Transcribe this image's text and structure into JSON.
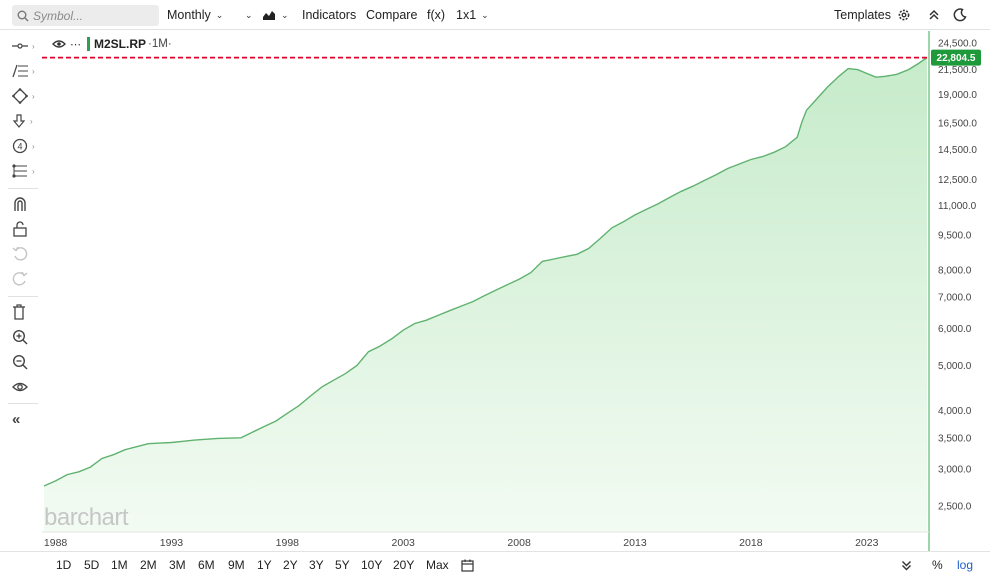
{
  "toolbar": {
    "search_placeholder": "Symbol...",
    "interval": "Monthly",
    "indicators": "Indicators",
    "compare": "Compare",
    "fx": "f(x)",
    "layout": "1x1",
    "templates": "Templates"
  },
  "legend": {
    "symbol": "M2SL.RP",
    "timeframe": "·1M·"
  },
  "watermark": "barchart",
  "range_buttons": [
    "1D",
    "5D",
    "1M",
    "2M",
    "3M",
    "6M",
    "9M",
    "1Y",
    "2Y",
    "3Y",
    "5Y",
    "10Y",
    "20Y",
    "Max"
  ],
  "bottom_right": {
    "percent": "%",
    "log": "log"
  },
  "colors": {
    "line": "#5fb26f",
    "fill": "#d4f0d6",
    "last_price_label": "#1f9a3b",
    "last_price_line": "#e2002a",
    "axis_line": "#3daa55"
  },
  "chart_data": {
    "type": "area",
    "scale": "log",
    "last_value": "22,804.5",
    "ylim": [
      2200,
      26000
    ],
    "xlim": [
      1987.5,
      2025.6
    ],
    "y_ticks": [
      "2,500.0",
      "3,000.0",
      "3,500.0",
      "4,000.0",
      "5,000.0",
      "6,000.0",
      "7,000.0",
      "8,000.0",
      "9,500.0",
      "11,000.0",
      "12,500.0",
      "14,500.0",
      "16,500.0",
      "19,000.0",
      "21,500.0",
      "24,500.0"
    ],
    "x_ticks": [
      "1988",
      "1993",
      "1998",
      "2003",
      "2008",
      "2013",
      "2018",
      "2023"
    ],
    "points": [
      [
        1987.5,
        2760
      ],
      [
        1988.0,
        2830
      ],
      [
        1988.5,
        2920
      ],
      [
        1989.0,
        2960
      ],
      [
        1989.5,
        3030
      ],
      [
        1990.0,
        3160
      ],
      [
        1990.5,
        3220
      ],
      [
        1991.0,
        3300
      ],
      [
        1991.5,
        3350
      ],
      [
        1992.0,
        3400
      ],
      [
        1992.5,
        3410
      ],
      [
        1993.0,
        3420
      ],
      [
        1993.5,
        3440
      ],
      [
        1994.0,
        3460
      ],
      [
        1995.0,
        3490
      ],
      [
        1996.0,
        3500
      ],
      [
        1996.5,
        3600
      ],
      [
        1997.0,
        3700
      ],
      [
        1997.5,
        3800
      ],
      [
        1998.0,
        3950
      ],
      [
        1998.5,
        4100
      ],
      [
        1999.0,
        4300
      ],
      [
        1999.5,
        4500
      ],
      [
        2000.0,
        4650
      ],
      [
        2000.5,
        4800
      ],
      [
        2001.0,
        5000
      ],
      [
        2001.5,
        5350
      ],
      [
        2002.0,
        5500
      ],
      [
        2002.5,
        5700
      ],
      [
        2003.0,
        5950
      ],
      [
        2003.5,
        6150
      ],
      [
        2004.0,
        6250
      ],
      [
        2004.5,
        6400
      ],
      [
        2005.0,
        6550
      ],
      [
        2005.5,
        6700
      ],
      [
        2006.0,
        6850
      ],
      [
        2006.5,
        7050
      ],
      [
        2007.0,
        7250
      ],
      [
        2007.5,
        7450
      ],
      [
        2008.0,
        7650
      ],
      [
        2008.5,
        7900
      ],
      [
        2009.0,
        8350
      ],
      [
        2009.5,
        8450
      ],
      [
        2010.0,
        8550
      ],
      [
        2010.5,
        8650
      ],
      [
        2011.0,
        8900
      ],
      [
        2011.5,
        9350
      ],
      [
        2012.0,
        9850
      ],
      [
        2012.5,
        10150
      ],
      [
        2013.0,
        10500
      ],
      [
        2013.5,
        10800
      ],
      [
        2014.0,
        11100
      ],
      [
        2014.5,
        11450
      ],
      [
        2015.0,
        11800
      ],
      [
        2015.5,
        12100
      ],
      [
        2016.0,
        12450
      ],
      [
        2016.5,
        12800
      ],
      [
        2017.0,
        13200
      ],
      [
        2017.5,
        13500
      ],
      [
        2018.0,
        13800
      ],
      [
        2018.5,
        14000
      ],
      [
        2019.0,
        14300
      ],
      [
        2019.5,
        14700
      ],
      [
        2020.0,
        15400
      ],
      [
        2020.2,
        16600
      ],
      [
        2020.4,
        17600
      ],
      [
        2020.8,
        18500
      ],
      [
        2021.3,
        19700
      ],
      [
        2021.8,
        20800
      ],
      [
        2022.2,
        21600
      ],
      [
        2022.6,
        21500
      ],
      [
        2023.0,
        21100
      ],
      [
        2023.4,
        20700
      ],
      [
        2023.8,
        20800
      ],
      [
        2024.3,
        21000
      ],
      [
        2024.8,
        21500
      ],
      [
        2025.2,
        22100
      ],
      [
        2025.6,
        22804.5
      ]
    ]
  }
}
